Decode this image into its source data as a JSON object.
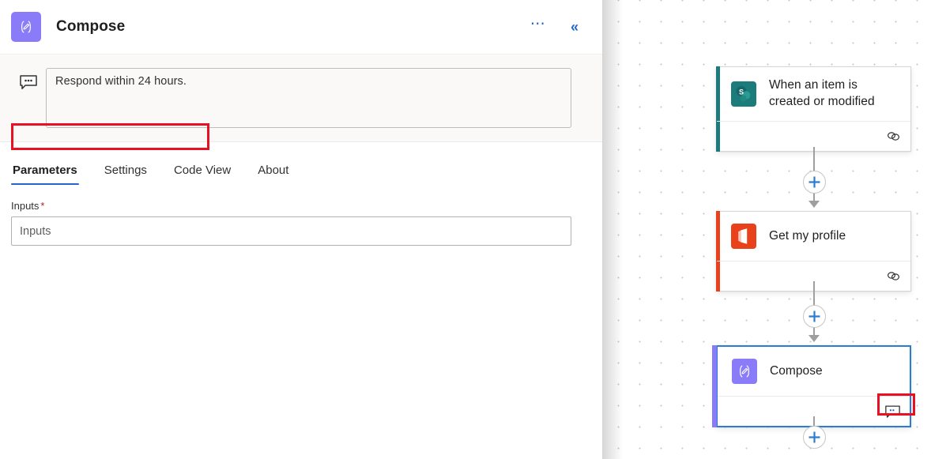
{
  "panel": {
    "title": "Compose",
    "icon": "compose-icon",
    "header_actions": [
      {
        "name": "more-options-button",
        "glyph": "⋯"
      },
      {
        "name": "collapse-panel-button",
        "glyph": "«"
      }
    ],
    "comment": {
      "icon": "comment-icon",
      "text": "Respond within 24 hours."
    },
    "tabs": [
      {
        "label": "Parameters",
        "active": true
      },
      {
        "label": "Settings",
        "active": false
      },
      {
        "label": "Code View",
        "active": false
      },
      {
        "label": "About",
        "active": false
      }
    ],
    "fields": [
      {
        "label": "Inputs",
        "required_marker": "*",
        "value": "",
        "placeholder": "Inputs"
      }
    ]
  },
  "canvas": {
    "nodes": [
      {
        "name": "when-an-item-is-created-or-modified",
        "title": "When an item is created or modified",
        "icon": "sharepoint-icon",
        "accent_color": "#1c7c7c",
        "selected": false,
        "footer_icon": "link-icon"
      },
      {
        "name": "get-my-profile",
        "title": "Get my profile",
        "icon": "office365-icon",
        "accent_color": "#e8411c",
        "selected": false,
        "footer_icon": "link-icon"
      },
      {
        "name": "compose",
        "title": "Compose",
        "icon": "compose-icon",
        "accent_color": "#8a7cf8",
        "selected": true,
        "footer_icon": "comment-icon"
      }
    ],
    "add_buttons": [
      {
        "name": "add-step-button-1",
        "glyph": "+"
      },
      {
        "name": "add-step-button-2",
        "glyph": "+"
      },
      {
        "name": "add-step-button-3",
        "glyph": "+"
      }
    ]
  },
  "colors": {
    "accent_blue": "#2266cc",
    "highlight_red": "#e81123",
    "sharepoint_teal": "#1c7c7c",
    "office_orange": "#e8411c",
    "compose_purple": "#8a7cf8"
  }
}
